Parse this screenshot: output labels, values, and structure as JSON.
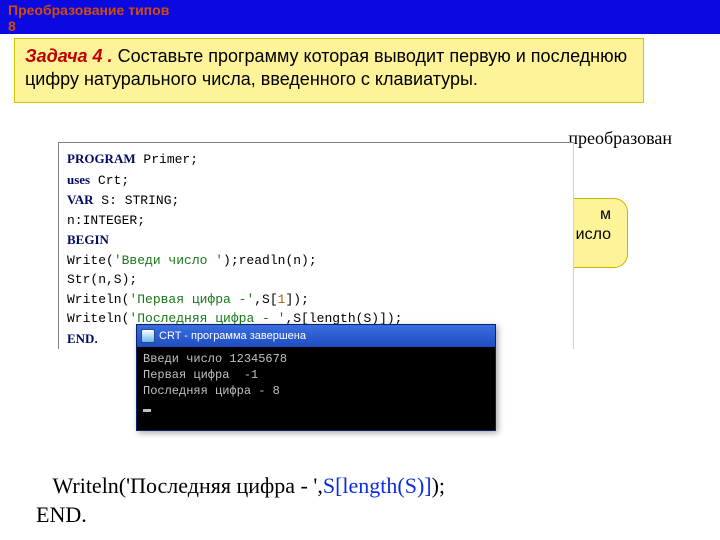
{
  "banner": {
    "line1": "Преобразование типов",
    "line2": "8"
  },
  "task": {
    "label": "Задача 4 .",
    "text": " Составьте программу которая выводит первую и последнюю цифру натурального числа, введенного с клавиатуры."
  },
  "partial_text": "преобразован",
  "code": {
    "l1_kw": "PROGRAM",
    "l1_rest": "  Primer;",
    "l2_kw": "uses",
    "l2_rest": " Crt;",
    "l3_kw": "VAR",
    "l3_rest": "  S: STRING;",
    "l4": "     n:INTEGER;",
    "l5_kw": "BEGIN",
    "l6a": "     Write(",
    "l6b": "'Введи число '",
    "l6c": ");readln(n);",
    "l7": "     Str(n,S);",
    "l8a": "     Writeln(",
    "l8b": "'Первая цифра  -'",
    "l8c": ",S[",
    "l8d": "1",
    "l8e": "]);",
    "l9a": "     Writeln(",
    "l9b": "'Последняя цифра - '",
    "l9c": ",S[length(S)]);",
    "l10_kw": "END."
  },
  "callout": {
    "line1": "м",
    "line2": "исло"
  },
  "console": {
    "title": "CRT - программа завершена",
    "line1": "Введи число 12345678",
    "line2": "Первая цифра  -1",
    "line3": "Последняя цифра - 8"
  },
  "bottom": {
    "writeln_open": "Writeln('Последняя цифра - ',",
    "expr": "S[length(S)]",
    "close": ");",
    "end": "END."
  }
}
